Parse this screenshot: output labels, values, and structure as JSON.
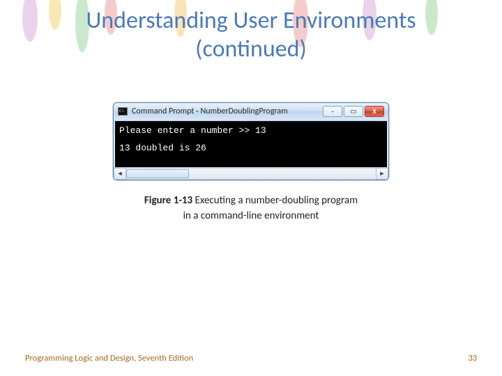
{
  "slide": {
    "title_line1": "Understanding User Environments",
    "title_line2": "(continued)"
  },
  "window": {
    "title": "Command Prompt - NumberDoublingProgram",
    "icon_name": "cmd-icon",
    "buttons": {
      "minimize_glyph": "–",
      "maximize_glyph": "▭",
      "close_glyph": "X"
    }
  },
  "console": {
    "line1": "Please enter a number >> 13",
    "line2": "13 doubled is 26"
  },
  "scrollbar": {
    "left_glyph": "◄",
    "right_glyph": "►"
  },
  "caption": {
    "figure_label": "Figure 1-13",
    "text_line1": " Executing a number-doubling program",
    "text_line2": "in a command-line environment"
  },
  "footer": {
    "book": "Programming Logic and Design, Seventh Edition",
    "page": "33"
  }
}
